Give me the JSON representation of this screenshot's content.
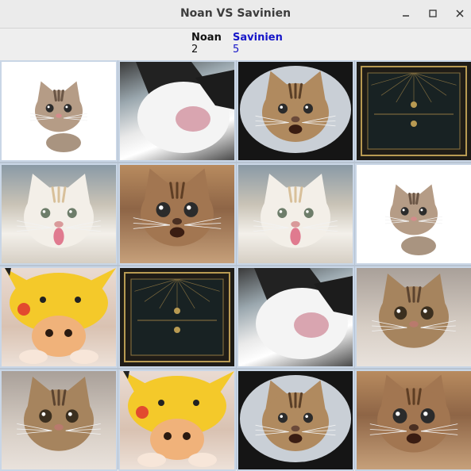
{
  "window": {
    "title": "Noan VS Savinien",
    "minimize_glyph": "–",
    "maximize_glyph": "□",
    "close_glyph": "✕"
  },
  "scoreboard": {
    "player1": {
      "name": "Noan",
      "score": "2",
      "color": "#111111"
    },
    "player2": {
      "name": "Savinien",
      "score": "5",
      "color": "#1515c8"
    }
  },
  "board": {
    "rows": 4,
    "columns": 4,
    "cards": [
      [
        "kitten-on-white",
        "black-white-cat-closeup",
        "fisheye-tabby-cat",
        "card-back-art-deco"
      ],
      [
        "white-cat-tongue-out",
        "tabby-cat-surprised",
        "white-cat-tongue-out",
        "kitten-on-white"
      ],
      [
        "kitten-pikachu-hat",
        "card-back-art-deco",
        "black-white-cat-closeup",
        "brown-tabby-cat"
      ],
      [
        "brown-tabby-cat",
        "kitten-pikachu-hat",
        "fisheye-tabby-cat",
        "tabby-cat-surprised"
      ]
    ]
  },
  "colors": {
    "titlebar": "#ebebeb",
    "board_background": "#b8c4d2",
    "card_border": "#c9d6e6"
  }
}
